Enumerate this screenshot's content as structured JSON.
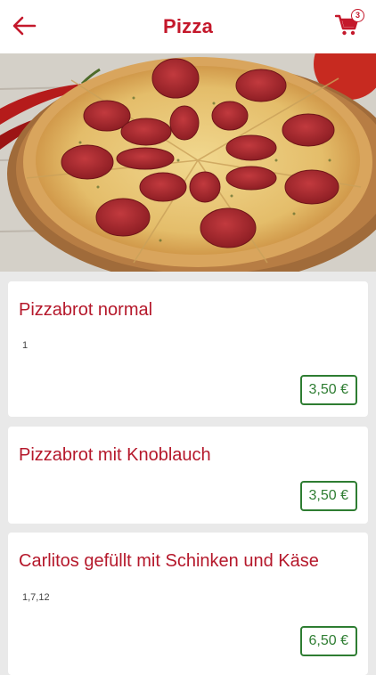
{
  "header": {
    "title": "Pizza",
    "back_icon": "arrow-left-icon",
    "cart_icon": "shopping-cart-icon",
    "cart_count": "3"
  },
  "hero": {
    "image": "pepperoni-pizza-photo"
  },
  "products": [
    {
      "name": "Pizzabrot normal",
      "allergens": "1",
      "price": "3,50 €"
    },
    {
      "name": "Pizzabrot mit Knoblauch",
      "allergens": "",
      "price": "3,50 €"
    },
    {
      "name": "Carlitos gefüllt mit Schinken und Käse",
      "allergens": "1,7,12",
      "price": "6,50 €"
    }
  ],
  "colors": {
    "accent": "#c4182b",
    "price": "#2e7d32",
    "background": "#e9e9e9"
  }
}
